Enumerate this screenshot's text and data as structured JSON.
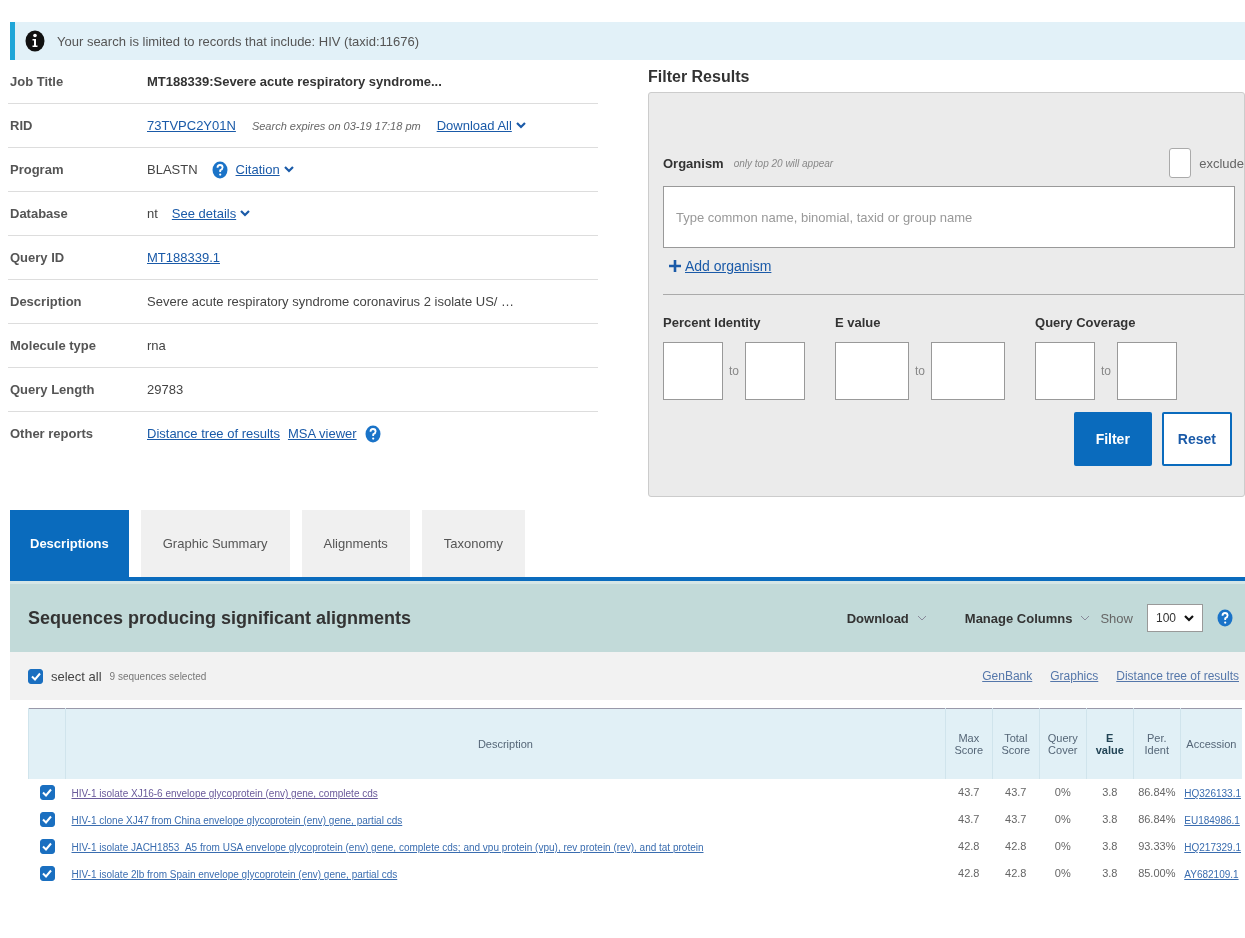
{
  "notice": {
    "text": "Your search is limited to records that include: HIV (taxid:11676)"
  },
  "job_info": [
    {
      "label": "Job Title",
      "parts": [
        {
          "kind": "bold",
          "text": "MT188339:Severe acute respiratory syndrome..."
        }
      ]
    },
    {
      "label": "RID",
      "parts": [
        {
          "kind": "link",
          "text": "73TVPC2Y01N"
        },
        {
          "kind": "note",
          "text": "Search expires on 03-19 17:18 pm"
        },
        {
          "kind": "link",
          "text": "Download All",
          "caret": true
        }
      ]
    },
    {
      "label": "Program",
      "parts": [
        {
          "kind": "text",
          "text": "BLASTN"
        },
        {
          "kind": "help"
        },
        {
          "kind": "link",
          "text": "Citation",
          "caret": true
        }
      ]
    },
    {
      "label": "Database",
      "parts": [
        {
          "kind": "text",
          "text": "nt"
        },
        {
          "kind": "link",
          "text": "See details",
          "caret": true
        }
      ]
    },
    {
      "label": "Query ID",
      "parts": [
        {
          "kind": "link",
          "text": "MT188339.1"
        }
      ]
    },
    {
      "label": "Description",
      "parts": [
        {
          "kind": "text",
          "text": "Severe acute respiratory syndrome coronavirus 2 isolate US/ …"
        }
      ]
    },
    {
      "label": "Molecule type",
      "parts": [
        {
          "kind": "text",
          "text": "rna"
        }
      ]
    },
    {
      "label": "Query Length",
      "parts": [
        {
          "kind": "text",
          "text": "29783"
        }
      ]
    },
    {
      "label": "Other reports",
      "parts": [
        {
          "kind": "link",
          "text": "Distance tree of results"
        },
        {
          "kind": "link",
          "text": "MSA viewer"
        },
        {
          "kind": "help"
        }
      ]
    }
  ],
  "filter": {
    "title": "Filter Results",
    "organism_label": "Organism",
    "organism_note": "only top 20 will appear",
    "exclude": {
      "label": "exclude",
      "checked": false
    },
    "organism_placeholder": "Type common name, binomial, taxid or group name",
    "add_organism": "Add organism",
    "ranges": [
      {
        "label": "Percent Identity",
        "to": "to"
      },
      {
        "label": "E value",
        "to": "to"
      },
      {
        "label": "Query Coverage",
        "to": "to"
      }
    ],
    "buttons": [
      {
        "label": "Filter",
        "primary": true
      },
      {
        "label": "Reset",
        "primary": false
      }
    ]
  },
  "tabs": [
    {
      "label": "Descriptions",
      "selected": true
    },
    {
      "label": "Graphic Summary",
      "selected": false
    },
    {
      "label": "Alignments",
      "selected": false
    },
    {
      "label": "Taxonomy",
      "selected": false
    }
  ],
  "results": {
    "title": "Sequences producing significant alignments",
    "download": "Download",
    "manage_columns": "Manage Columns",
    "show_label": "Show",
    "show_value": "100",
    "select_all": {
      "label": "select all",
      "checked": true
    },
    "selected_count": "9 sequences selected",
    "links": [
      "GenBank",
      "Graphics",
      "Distance tree of results"
    ],
    "columns": [
      {
        "label": "Description",
        "sorted": false
      },
      {
        "label": "Max Score",
        "sorted": false
      },
      {
        "label": "Total Score",
        "sorted": false
      },
      {
        "label": "Query Cover",
        "sorted": false
      },
      {
        "label": "E value",
        "sorted": true
      },
      {
        "label": "Per. Ident",
        "sorted": false
      },
      {
        "label": "Accession",
        "sorted": false
      }
    ],
    "rows": [
      {
        "checked": true,
        "visited": true,
        "description": "HIV-1 isolate XJ16-6 envelope glycoprotein (env) gene, complete cds",
        "max_score": "43.7",
        "total_score": "43.7",
        "query_cover": "0%",
        "e_value": "3.8",
        "per_ident": "86.84%",
        "accession": "HQ326133.1"
      },
      {
        "checked": true,
        "visited": false,
        "description": "HIV-1 clone XJ47 from China envelope glycoprotein (env) gene, partial cds",
        "max_score": "43.7",
        "total_score": "43.7",
        "query_cover": "0%",
        "e_value": "3.8",
        "per_ident": "86.84%",
        "accession": "EU184986.1"
      },
      {
        "checked": true,
        "visited": false,
        "description": "HIV-1 isolate JACH1853_A5 from USA envelope glycoprotein (env) gene, complete cds; and vpu protein (vpu), rev protein (rev), and tat protein",
        "max_score": "42.8",
        "total_score": "42.8",
        "query_cover": "0%",
        "e_value": "3.8",
        "per_ident": "93.33%",
        "accession": "HQ217329.1"
      },
      {
        "checked": true,
        "visited": false,
        "description": "HIV-1 isolate 2lb from Spain envelope glycoprotein (env) gene, partial cds",
        "max_score": "42.8",
        "total_score": "42.8",
        "query_cover": "0%",
        "e_value": "3.8",
        "per_ident": "85.00%",
        "accession": "AY682109.1"
      }
    ]
  }
}
